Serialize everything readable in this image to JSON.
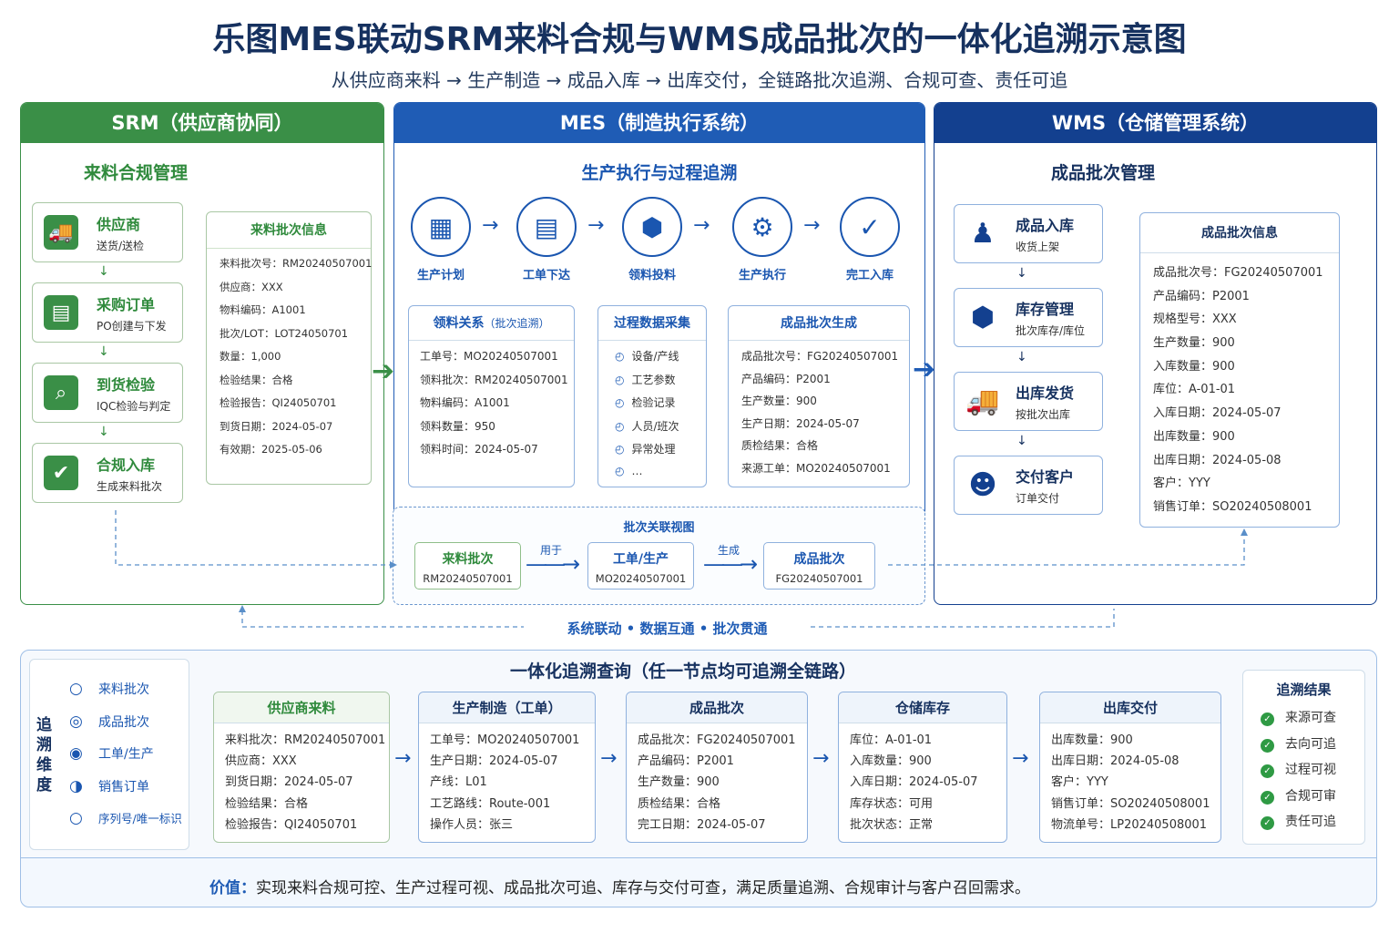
{
  "title": "乐图MES联动SRM来料合规与WMS成品批次的一体化追溯示意图",
  "subtitle": "从供应商来料 → 生产制造 → 成品入库 → 出库交付，全链路批次追溯、合规可查、责任可追",
  "colors": {
    "srm": "#3a8f47",
    "mes": "#1f5cb5",
    "wms": "#13408f",
    "check": "#2f9a44"
  },
  "srm": {
    "header": "SRM（供应商协同）",
    "section": "来料合规管理",
    "steps": [
      {
        "title": "供应商",
        "desc": "送货/送检",
        "icon": "truck-icon"
      },
      {
        "title": "采购订单",
        "desc": "PO创建与下发",
        "icon": "document-icon"
      },
      {
        "title": "到货检验",
        "desc": "IQC检验与判定",
        "icon": "magnifier-check-icon"
      },
      {
        "title": "合规入库",
        "desc": "生成来料批次",
        "icon": "checkbox-icon"
      }
    ],
    "info_title": "来料批次信息",
    "info": [
      "来料批次号：RM20240507001",
      "供应商：XXX",
      "物料编码：A1001",
      "批次/LOT：LOT24050701",
      "数量：1,000",
      "检验结果：合格",
      "检验报告：QI24050701",
      "到货日期：2024-05-07",
      "有效期：2025-05-06"
    ]
  },
  "mes": {
    "header": "MES（制造执行系统）",
    "section": "生产执行与过程追溯",
    "flow": [
      {
        "label": "生产计划",
        "icon": "calendar-icon"
      },
      {
        "label": "工单下达",
        "icon": "document-icon"
      },
      {
        "label": "领料投料",
        "icon": "box-icon"
      },
      {
        "label": "生产执行",
        "icon": "gear-icon"
      },
      {
        "label": "完工入库",
        "icon": "clipboard-check-icon"
      }
    ],
    "box1": {
      "title": "领料关系",
      "title_sub": "（批次追溯）",
      "rows": [
        "工单号：MO20240507001",
        "领料批次：RM20240507001",
        "物料编码：A1001",
        "领料数量：950",
        "领料时间：2024-05-07"
      ]
    },
    "box2": {
      "title": "过程数据采集",
      "rows": [
        "设备/产线",
        "工艺参数",
        "检验记录",
        "人员/班次",
        "异常处理",
        "…"
      ]
    },
    "box3": {
      "title": "成品批次生成",
      "rows": [
        "成品批次号：FG20240507001",
        "产品编码：P2001",
        "生产数量：900",
        "生产日期：2024-05-07",
        "质检结果：合格",
        "来源工单：MO20240507001"
      ]
    },
    "relation": {
      "title": "批次关联视图",
      "nodes": [
        {
          "title": "来料批次",
          "id": "RM20240507001"
        },
        {
          "title": "工单/生产",
          "id": "MO20240507001"
        },
        {
          "title": "成品批次",
          "id": "FG20240507001"
        }
      ],
      "edges": [
        "用于",
        "生成"
      ]
    }
  },
  "wms": {
    "header": "WMS（仓储管理系统）",
    "section": "成品批次管理",
    "steps": [
      {
        "title": "成品入库",
        "desc": "收货上架",
        "icon": "worker-icon"
      },
      {
        "title": "库存管理",
        "desc": "批次库存/库位",
        "icon": "box-icon"
      },
      {
        "title": "出库发货",
        "desc": "按批次出库",
        "icon": "truck-icon"
      },
      {
        "title": "交付客户",
        "desc": "订单交付",
        "icon": "user-icon"
      }
    ],
    "info_title": "成品批次信息",
    "info": [
      "成品批次号：FG20240507001",
      "产品编码：P2001",
      "规格型号：XXX",
      "生产数量：900",
      "入库数量：900",
      "库位：A-01-01",
      "入库日期：2024-05-07",
      "出库数量：900",
      "出库日期：2024-05-08",
      "客户：YYY",
      "销售订单：SO20240508001"
    ]
  },
  "link_text": "系统联动 • 数据互通 • 批次贯通",
  "bottom": {
    "title": "一体化追溯查询（任一节点均可追溯全链路）",
    "dim_title": "追溯维度",
    "dims": [
      "来料批次",
      "成品批次",
      "工单/生产",
      "销售订单",
      "序列号/唯一标识"
    ],
    "cards": [
      {
        "title": "供应商来料",
        "rows": [
          "来料批次：RM20240507001",
          "供应商：XXX",
          "到货日期：2024-05-07",
          "检验结果：合格",
          "检验报告：QI24050701"
        ]
      },
      {
        "title": "生产制造（工单）",
        "rows": [
          "工单号：MO20240507001",
          "生产日期：2024-05-07",
          "产线：L01",
          "工艺路线：Route-001",
          "操作人员：张三"
        ]
      },
      {
        "title": "成品批次",
        "rows": [
          "成品批次：FG20240507001",
          "产品编码：P2001",
          "生产数量：900",
          "质检结果：合格",
          "完工日期：2024-05-07"
        ]
      },
      {
        "title": "仓储库存",
        "rows": [
          "库位：A-01-01",
          "入库数量：900",
          "入库日期：2024-05-07",
          "库存状态：可用",
          "批次状态：正常"
        ]
      },
      {
        "title": "出库交付",
        "rows": [
          "出库数量：900",
          "出库日期：2024-05-08",
          "客户：YYY",
          "销售订单：SO20240508001",
          "物流单号：LP20240508001"
        ]
      }
    ],
    "result_title": "追溯结果",
    "results": [
      "来源可查",
      "去向可追",
      "过程可视",
      "合规可审",
      "责任可追"
    ]
  },
  "value": {
    "label": "价值：",
    "text": "实现来料合规可控、生产过程可视、成品批次可追、库存与交付可查，满足质量追溯、合规审计与客户召回需求。"
  }
}
